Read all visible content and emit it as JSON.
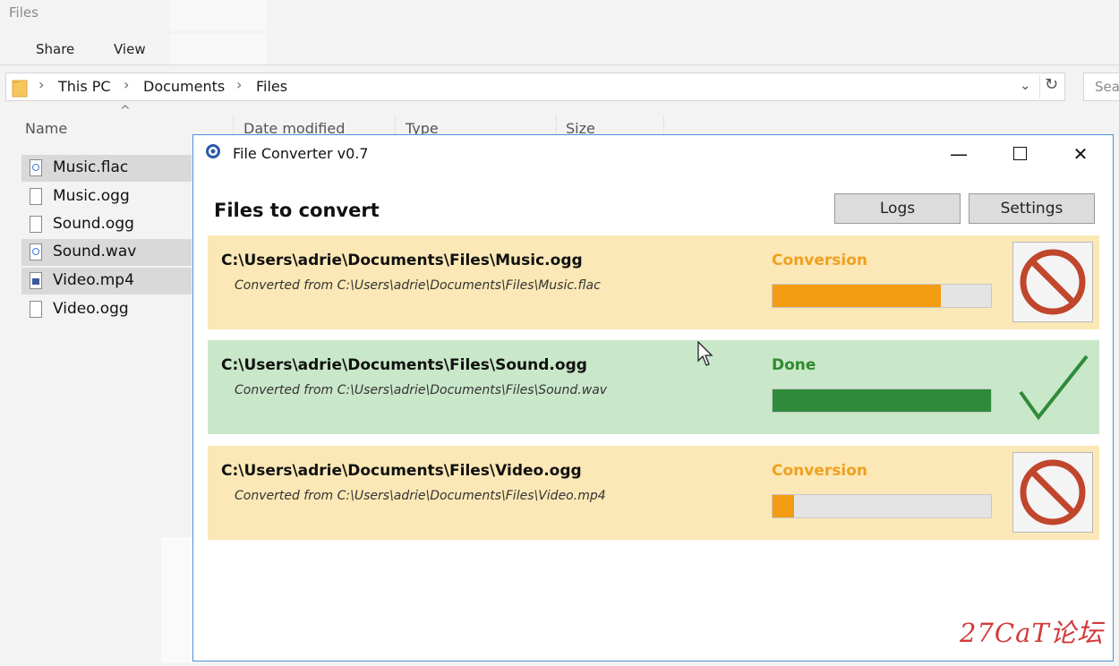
{
  "explorer": {
    "title": "Files",
    "ribbon": {
      "share": "Share",
      "view": "View"
    },
    "breadcrumb": [
      "This PC",
      "Documents",
      "Files"
    ],
    "search_placeholder": "Sea",
    "columns": {
      "name": "Name",
      "date_modified": "Date modified",
      "type": "Type",
      "size": "Size"
    },
    "files": [
      {
        "name": "Music.flac",
        "icon": "media-file-icon",
        "selected": true
      },
      {
        "name": "Music.ogg",
        "icon": "file-icon",
        "selected": false
      },
      {
        "name": "Sound.ogg",
        "icon": "file-icon",
        "selected": false
      },
      {
        "name": "Sound.wav",
        "icon": "media-file-icon",
        "selected": true
      },
      {
        "name": "Video.mp4",
        "icon": "video-file-icon",
        "selected": true
      },
      {
        "name": "Video.ogg",
        "icon": "file-icon",
        "selected": false
      }
    ]
  },
  "converter": {
    "title": "File Converter v0.7",
    "heading": "Files to convert",
    "logs_label": "Logs",
    "settings_label": "Settings",
    "jobs": [
      {
        "path": "C:\\Users\\adrie\\Documents\\Files\\Music.ogg",
        "source": "Converted from C:\\Users\\adrie\\Documents\\Files\\Music.flac",
        "status": "Conversion",
        "state": "converting",
        "progress": 0.77
      },
      {
        "path": "C:\\Users\\adrie\\Documents\\Files\\Sound.ogg",
        "source": "Converted from C:\\Users\\adrie\\Documents\\Files\\Sound.wav",
        "status": "Done",
        "state": "done",
        "progress": 1.0
      },
      {
        "path": "C:\\Users\\adrie\\Documents\\Files\\Video.ogg",
        "source": "Converted from C:\\Users\\adrie\\Documents\\Files\\Video.mp4",
        "status": "Conversion",
        "state": "converting",
        "progress": 0.1
      }
    ]
  },
  "watermark": "27CaT论坛",
  "colors": {
    "converting_bg": "#fbe8b6",
    "done_bg": "#c9e7c9",
    "progress_orange": "#f39c12",
    "progress_green": "#2e8b3a",
    "cancel_red": "#c0462c",
    "window_border": "#4a90d9"
  }
}
